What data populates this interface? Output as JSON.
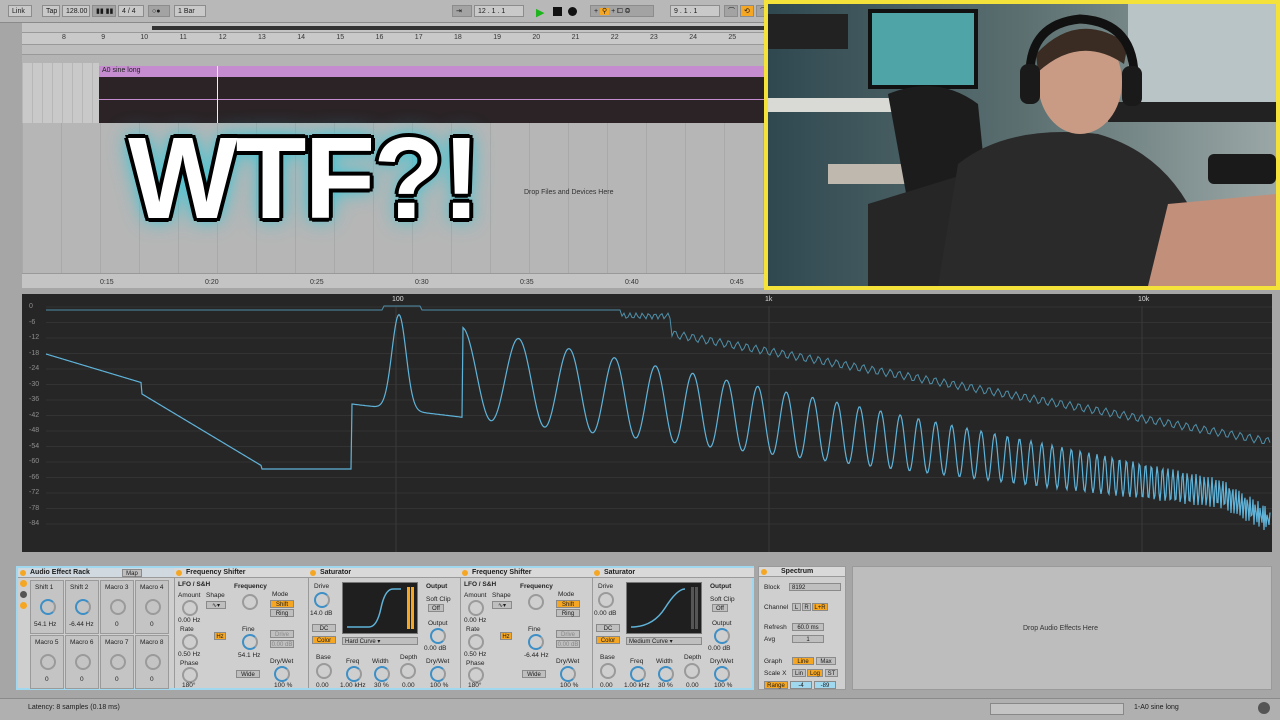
{
  "transport": {
    "link": "Link",
    "tap": "Tap",
    "tempo": "128.00",
    "sig": "4 / 4",
    "quant": "1 Bar",
    "position": "12 .  1 .  1",
    "loop_start": "9 .  1 .  1"
  },
  "arrangement": {
    "ruler": [
      "8",
      "9",
      "10",
      "11",
      "12",
      "13",
      "14",
      "15",
      "16",
      "17",
      "18",
      "19",
      "20",
      "21",
      "22",
      "23",
      "24",
      "25"
    ],
    "times": [
      "0:15",
      "0:20",
      "0:25",
      "0:30",
      "0:35",
      "0:40",
      "0:45"
    ],
    "clip_name": "A0 sine long",
    "drop_text": "Drop Files and Devices Here"
  },
  "overlay": {
    "text": "WTF?!"
  },
  "spectrum": {
    "db_labels": [
      "0",
      "-6",
      "-12",
      "-18",
      "-24",
      "-30",
      "-36",
      "-42",
      "-48",
      "-54",
      "-60",
      "-66",
      "-72",
      "-78",
      "-84"
    ],
    "freq_labels": [
      "100",
      "1k",
      "10k"
    ],
    "line_color": "#5fb3d9"
  },
  "rack": {
    "title": "Audio Effect Rack",
    "map": "Map",
    "macros": [
      {
        "name": "Shift 1",
        "value": "54.1 Hz"
      },
      {
        "name": "Shift 2",
        "value": "-6.44 Hz"
      },
      {
        "name": "Macro 3",
        "value": "0"
      },
      {
        "name": "Macro 4",
        "value": "0"
      },
      {
        "name": "Macro 5",
        "value": "0"
      },
      {
        "name": "Macro 6",
        "value": "0"
      },
      {
        "name": "Macro 7",
        "value": "0"
      },
      {
        "name": "Macro 8",
        "value": "0"
      }
    ]
  },
  "fs1": {
    "title": "Frequency Shifter",
    "lfo": "LFO / S&H",
    "amount_l": "Amount",
    "amount": "0.00 Hz",
    "shape": "Shape",
    "rate_l": "Rate",
    "rate": "0.50 Hz",
    "hz": "Hz",
    "phase_l": "Phase",
    "phase": "180°",
    "freq_l": "Frequency",
    "fine_l": "Fine",
    "fine": "54.1 Hz",
    "mode_l": "Mode",
    "shift": "Shift",
    "ring": "Ring",
    "drive": "Drive",
    "drive_v": "0.00 dB",
    "wide": "Wide",
    "drywet_l": "Dry/Wet",
    "drywet": "100 %"
  },
  "sat1": {
    "title": "Saturator",
    "drive_l": "Drive",
    "drive": "14.0 dB",
    "dc": "DC",
    "color": "Color",
    "curve": "Hard Curve",
    "output": "Output",
    "softclip": "Soft Clip",
    "off": "Off",
    "output_l": "Output",
    "output_v": "0.00 dB",
    "drywet_l": "Dry/Wet",
    "drywet": "100 %",
    "base_l": "Base",
    "base": "0.00",
    "freq_l": "Freq",
    "freq": "1.00 kHz",
    "width_l": "Width",
    "width": "30 %",
    "depth_l": "Depth",
    "depth": "0.00"
  },
  "fs2": {
    "title": "Frequency Shifter",
    "lfo": "LFO / S&H",
    "amount_l": "Amount",
    "amount": "0.00 Hz",
    "shape": "Shape",
    "rate_l": "Rate",
    "rate": "0.50 Hz",
    "hz": "Hz",
    "phase_l": "Phase",
    "phase": "180°",
    "freq_l": "Frequency",
    "fine_l": "Fine",
    "fine": "-6.44 Hz",
    "mode_l": "Mode",
    "shift": "Shift",
    "ring": "Ring",
    "drive": "Drive",
    "drive_v": "0.00 dB",
    "wide": "Wide",
    "drywet_l": "Dry/Wet",
    "drywet": "100 %"
  },
  "sat2": {
    "title": "Saturator",
    "drive_l": "Drive",
    "drive": "0.00 dB",
    "dc": "DC",
    "color": "Color",
    "curve": "Medium Curve",
    "output": "Output",
    "softclip": "Soft Clip",
    "off": "Off",
    "output_l": "Output",
    "output_v": "0.00 dB",
    "drywet_l": "Dry/Wet",
    "drywet": "100 %",
    "base_l": "Base",
    "base": "0.00",
    "freq_l": "Freq",
    "freq": "1.00 kHz",
    "width_l": "Width",
    "width": "30 %",
    "depth_l": "Depth",
    "depth": "0.00"
  },
  "spectrum_dev": {
    "title": "Spectrum",
    "block_l": "Block",
    "block": "8192",
    "channel_l": "Channel",
    "l": "L",
    "r": "R",
    "lr": "L+R",
    "refresh_l": "Refresh",
    "refresh": "60.0 ms",
    "avg_l": "Avg",
    "avg": "1",
    "graph_l": "Graph",
    "line": "Line",
    "max": "Max",
    "scalex_l": "Scale X",
    "lin": "Lin",
    "log": "Log",
    "st": "ST",
    "range_l": "Range",
    "range_a": "-4",
    "range_b": "-89"
  },
  "drop_fx": "Drop Audio Effects Here",
  "status": {
    "latency": "Latency: 8 samples (0.18 ms)",
    "track": "1-A0 sine long"
  }
}
